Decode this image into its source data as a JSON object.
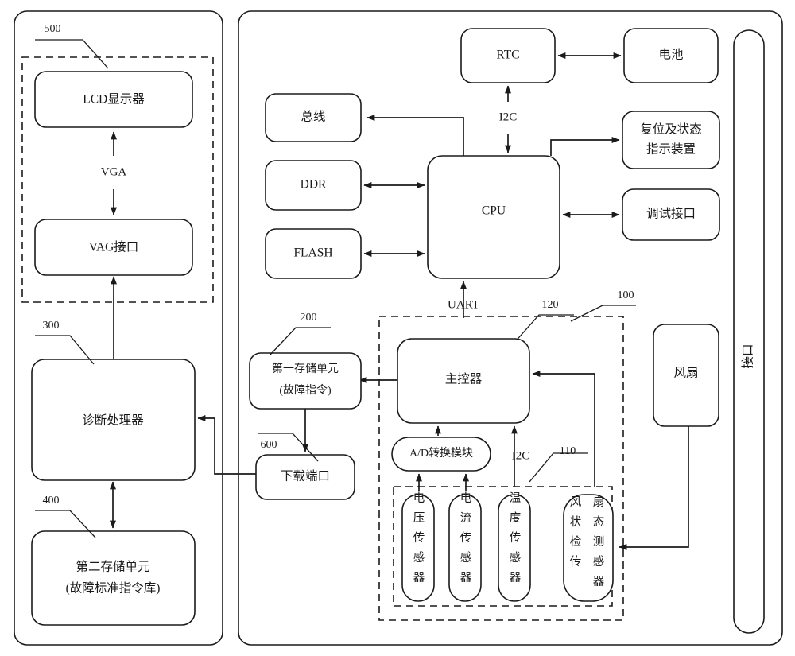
{
  "diagram": {
    "type": "patent-block-diagram",
    "left_panel": {
      "ref_500": "500",
      "ref_300": "300",
      "ref_400": "400",
      "blocks": {
        "lcd": "LCD显示器",
        "vga_if": "VAG接口",
        "diag_proc": "诊断处理器",
        "mem2_line1": "第二存储单元",
        "mem2_line2": "(故障标准指令库)"
      },
      "signals": {
        "vga": "VGA"
      }
    },
    "right_panel": {
      "ref_100": "100",
      "ref_110": "110",
      "ref_120": "120",
      "ref_200": "200",
      "ref_600": "600",
      "blocks": {
        "rtc": "RTC",
        "battery": "电池",
        "bus": "总线",
        "ddr": "DDR",
        "flash": "FLASH",
        "cpu": "CPU",
        "reset_line1": "复位及状态",
        "reset_line2": "指示装置",
        "debug_if": "调试接口",
        "mem1_line1": "第一存储单元",
        "mem1_line2": "(故障指令)",
        "download_port": "下载端口",
        "main_ctrl": "主控器",
        "adc": "A/D转换模块",
        "fan": "风扇",
        "interface": "接口"
      },
      "signals": {
        "i2c_top": "I2C",
        "i2c_bottom": "I2C",
        "uart": "UART"
      },
      "sensors": [
        {
          "name": "voltage-sensor",
          "chars": "电压传感器"
        },
        {
          "name": "current-sensor",
          "chars": "电流传感器"
        },
        {
          "name": "temperature-sensor",
          "chars": "温度传感器"
        },
        {
          "name": "fan-state-sensor",
          "col1": "风状检传",
          "col2": "扇态测感器"
        }
      ]
    },
    "colors": {
      "stroke": "#1a1a1a",
      "fill": "#ffffff"
    }
  }
}
